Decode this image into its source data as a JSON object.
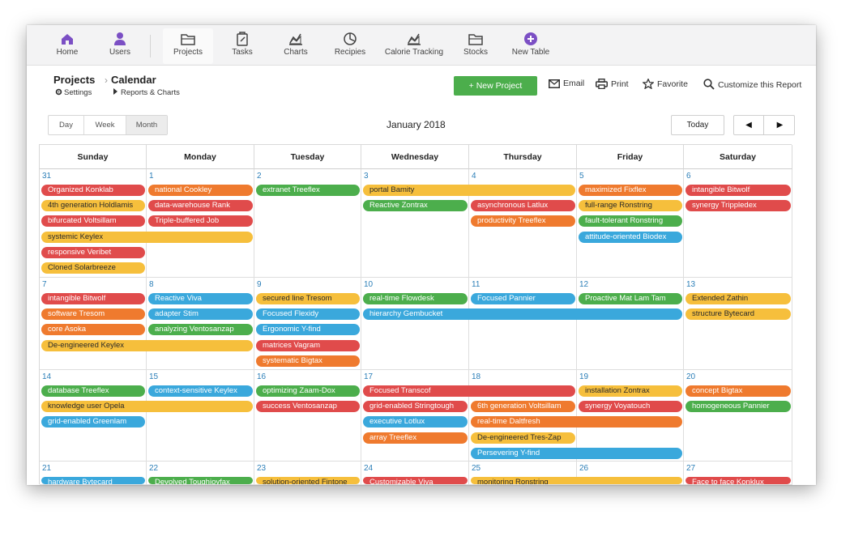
{
  "nav": {
    "items": [
      {
        "label": "Home",
        "icon": "home-icon"
      },
      {
        "label": "Users",
        "icon": "user-icon"
      },
      {
        "label": "Projects",
        "icon": "folder-icon"
      },
      {
        "label": "Tasks",
        "icon": "clipboard-icon"
      },
      {
        "label": "Charts",
        "icon": "chart-icon"
      },
      {
        "label": "Recipies",
        "icon": "pie-icon"
      },
      {
        "label": "Calorie Tracking",
        "icon": "chart-icon"
      },
      {
        "label": "Stocks",
        "icon": "folder-icon"
      },
      {
        "label": "New Table",
        "icon": "plus-circle-icon"
      }
    ],
    "active": "Projects"
  },
  "header": {
    "breadcrumb_parent": "Projects",
    "breadcrumb_sep": "›",
    "breadcrumb_current": "Calendar",
    "settings_label": "Settings",
    "reports_label": "Reports & Charts",
    "new_project_label": "+ New Project",
    "email_label": "Email",
    "print_label": "Print",
    "favorite_label": "Favorite",
    "customize_label": "Customize this Report"
  },
  "toolbar": {
    "views": [
      "Day",
      "Week",
      "Month"
    ],
    "active_view": "Month",
    "month_title": "January 2018",
    "today_label": "Today",
    "prev_glyph": "◀",
    "next_glyph": "▶"
  },
  "colors": {
    "red": "#e04b4b",
    "orange": "#ef7a2e",
    "yellow": "#f6bf3c",
    "green": "#4cae4c",
    "blue": "#3aa8dc",
    "primary_button": "#4cae4c",
    "day_number": "#2c7fb8"
  },
  "calendar": {
    "weekdays": [
      "Sunday",
      "Monday",
      "Tuesday",
      "Wednesday",
      "Thursday",
      "Friday",
      "Saturday"
    ],
    "weeks": [
      {
        "days": [
          "31",
          "1",
          "2",
          "3",
          "4",
          "5",
          "6"
        ],
        "events": [
          {
            "text": "Organized Konklab",
            "day": 0,
            "span": 1,
            "lane": 0,
            "color": "red"
          },
          {
            "text": "4th generation Holdlamis",
            "day": 0,
            "span": 1,
            "lane": 1,
            "color": "yellow"
          },
          {
            "text": "bifurcated Voltsillam",
            "day": 0,
            "span": 1,
            "lane": 2,
            "color": "red"
          },
          {
            "text": "systemic Keylex",
            "day": 0,
            "span": 2,
            "lane": 3,
            "color": "yellow"
          },
          {
            "text": "responsive Veribet",
            "day": 0,
            "span": 1,
            "lane": 4,
            "color": "red"
          },
          {
            "text": "Cloned Solarbreeze",
            "day": 0,
            "span": 1,
            "lane": 5,
            "color": "yellow"
          },
          {
            "text": "national Cookley",
            "day": 1,
            "span": 1,
            "lane": 0,
            "color": "orange"
          },
          {
            "text": "data-warehouse Rank",
            "day": 1,
            "span": 1,
            "lane": 1,
            "color": "red"
          },
          {
            "text": "Triple-buffered Job",
            "day": 1,
            "span": 1,
            "lane": 2,
            "color": "red"
          },
          {
            "text": "extranet Treeflex",
            "day": 2,
            "span": 1,
            "lane": 0,
            "color": "green"
          },
          {
            "text": "portal Bamity",
            "day": 3,
            "span": 2,
            "lane": 0,
            "color": "yellow"
          },
          {
            "text": "Reactive Zontrax",
            "day": 3,
            "span": 1,
            "lane": 1,
            "color": "green"
          },
          {
            "text": "asynchronous Latlux",
            "day": 4,
            "span": 1,
            "lane": 1,
            "color": "red"
          },
          {
            "text": "productivity Treeflex",
            "day": 4,
            "span": 1,
            "lane": 2,
            "color": "orange"
          },
          {
            "text": "maximized Fixflex",
            "day": 5,
            "span": 1,
            "lane": 0,
            "color": "orange"
          },
          {
            "text": "full-range Ronstring",
            "day": 5,
            "span": 1,
            "lane": 1,
            "color": "yellow"
          },
          {
            "text": "fault-tolerant Ronstring",
            "day": 5,
            "span": 1,
            "lane": 2,
            "color": "green"
          },
          {
            "text": "attitude-oriented Biodex",
            "day": 5,
            "span": 1,
            "lane": 3,
            "color": "blue"
          },
          {
            "text": "intangible Bitwolf",
            "day": 6,
            "span": 1,
            "lane": 0,
            "color": "red"
          },
          {
            "text": "synergy Trippledex",
            "day": 6,
            "span": 1,
            "lane": 1,
            "color": "red"
          }
        ]
      },
      {
        "days": [
          "7",
          "8",
          "9",
          "10",
          "11",
          "12",
          "13"
        ],
        "events": [
          {
            "text": "intangible Bitwolf",
            "day": 0,
            "span": 1,
            "lane": 0,
            "color": "red"
          },
          {
            "text": "software Tresom",
            "day": 0,
            "span": 1,
            "lane": 1,
            "color": "orange"
          },
          {
            "text": "core Asoka",
            "day": 0,
            "span": 1,
            "lane": 2,
            "color": "orange"
          },
          {
            "text": "De-engineered Keylex",
            "day": 0,
            "span": 2,
            "lane": 3,
            "color": "yellow"
          },
          {
            "text": "Reactive Viva",
            "day": 1,
            "span": 1,
            "lane": 0,
            "color": "blue"
          },
          {
            "text": "adapter Stim",
            "day": 1,
            "span": 1,
            "lane": 1,
            "color": "blue"
          },
          {
            "text": "analyzing Ventosanzap",
            "day": 1,
            "span": 1,
            "lane": 2,
            "color": "green"
          },
          {
            "text": "secured line Tresom",
            "day": 2,
            "span": 1,
            "lane": 0,
            "color": "yellow"
          },
          {
            "text": "Focused Flexidy",
            "day": 2,
            "span": 1,
            "lane": 1,
            "color": "blue"
          },
          {
            "text": "Ergonomic Y-find",
            "day": 2,
            "span": 1,
            "lane": 2,
            "color": "blue"
          },
          {
            "text": "matrices Vagram",
            "day": 2,
            "span": 1,
            "lane": 3,
            "color": "red"
          },
          {
            "text": "systematic Bigtax",
            "day": 2,
            "span": 1,
            "lane": 4,
            "color": "orange"
          },
          {
            "text": "real-time Flowdesk",
            "day": 3,
            "span": 1,
            "lane": 0,
            "color": "green"
          },
          {
            "text": "hierarchy Gembucket",
            "day": 3,
            "span": 3,
            "lane": 1,
            "color": "blue"
          },
          {
            "text": "Focused Pannier",
            "day": 4,
            "span": 1,
            "lane": 0,
            "color": "blue"
          },
          {
            "text": "Proactive Mat Lam Tam",
            "day": 5,
            "span": 1,
            "lane": 0,
            "color": "green"
          },
          {
            "text": "Extended Zathin",
            "day": 6,
            "span": 1,
            "lane": 0,
            "color": "yellow"
          },
          {
            "text": "structure Bytecard",
            "day": 6,
            "span": 1,
            "lane": 1,
            "color": "yellow"
          }
        ]
      },
      {
        "days": [
          "14",
          "15",
          "16",
          "17",
          "18",
          "19",
          "20"
        ],
        "events": [
          {
            "text": "database Treeflex",
            "day": 0,
            "span": 1,
            "lane": 0,
            "color": "green"
          },
          {
            "text": "knowledge user Opela",
            "day": 0,
            "span": 2,
            "lane": 1,
            "color": "yellow"
          },
          {
            "text": "grid-enabled Greenlam",
            "day": 0,
            "span": 1,
            "lane": 2,
            "color": "blue"
          },
          {
            "text": "context-sensitive Keylex",
            "day": 1,
            "span": 1,
            "lane": 0,
            "color": "blue"
          },
          {
            "text": "optimizing Zaam-Dox",
            "day": 2,
            "span": 1,
            "lane": 0,
            "color": "green"
          },
          {
            "text": "success Ventosanzap",
            "day": 2,
            "span": 1,
            "lane": 1,
            "color": "red"
          },
          {
            "text": "Focused Transcof",
            "day": 3,
            "span": 2,
            "lane": 0,
            "color": "red"
          },
          {
            "text": "grid-enabled Stringtough",
            "day": 3,
            "span": 1,
            "lane": 1,
            "color": "red"
          },
          {
            "text": "executive Lotlux",
            "day": 3,
            "span": 1,
            "lane": 2,
            "color": "blue"
          },
          {
            "text": "array Treeflex",
            "day": 3,
            "span": 1,
            "lane": 3,
            "color": "orange"
          },
          {
            "text": "6th generation Voltsillam",
            "day": 4,
            "span": 1,
            "lane": 1,
            "color": "orange"
          },
          {
            "text": "real-time Daltfresh",
            "day": 4,
            "span": 2,
            "lane": 2,
            "color": "orange"
          },
          {
            "text": "De-engineered Tres-Zap",
            "day": 4,
            "span": 1,
            "lane": 3,
            "color": "yellow"
          },
          {
            "text": "Persevering Y-find",
            "day": 4,
            "span": 2,
            "lane": 4,
            "color": "blue"
          },
          {
            "text": "installation Zontrax",
            "day": 5,
            "span": 1,
            "lane": 0,
            "color": "yellow"
          },
          {
            "text": "synergy Voyatouch",
            "day": 5,
            "span": 1,
            "lane": 1,
            "color": "red"
          },
          {
            "text": "concept Bigtax",
            "day": 6,
            "span": 1,
            "lane": 0,
            "color": "orange"
          },
          {
            "text": "homogeneous Pannier",
            "day": 6,
            "span": 1,
            "lane": 1,
            "color": "green"
          }
        ]
      },
      {
        "days": [
          "21",
          "22",
          "23",
          "24",
          "25",
          "26",
          "27"
        ],
        "events": [
          {
            "text": "hardware Bytecard",
            "day": 0,
            "span": 1,
            "lane": 0,
            "color": "blue"
          },
          {
            "text": "Devolved Toughjoyfax",
            "day": 1,
            "span": 1,
            "lane": 0,
            "color": "green"
          },
          {
            "text": "solution-oriented Fintone",
            "day": 2,
            "span": 1,
            "lane": 0,
            "color": "yellow"
          },
          {
            "text": "Customizable Viva",
            "day": 3,
            "span": 1,
            "lane": 0,
            "color": "red"
          },
          {
            "text": "monitoring Ronstring",
            "day": 4,
            "span": 2,
            "lane": 0,
            "color": "yellow"
          },
          {
            "text": "Face to face Konklux",
            "day": 6,
            "span": 1,
            "lane": 0,
            "color": "red"
          }
        ]
      }
    ]
  }
}
